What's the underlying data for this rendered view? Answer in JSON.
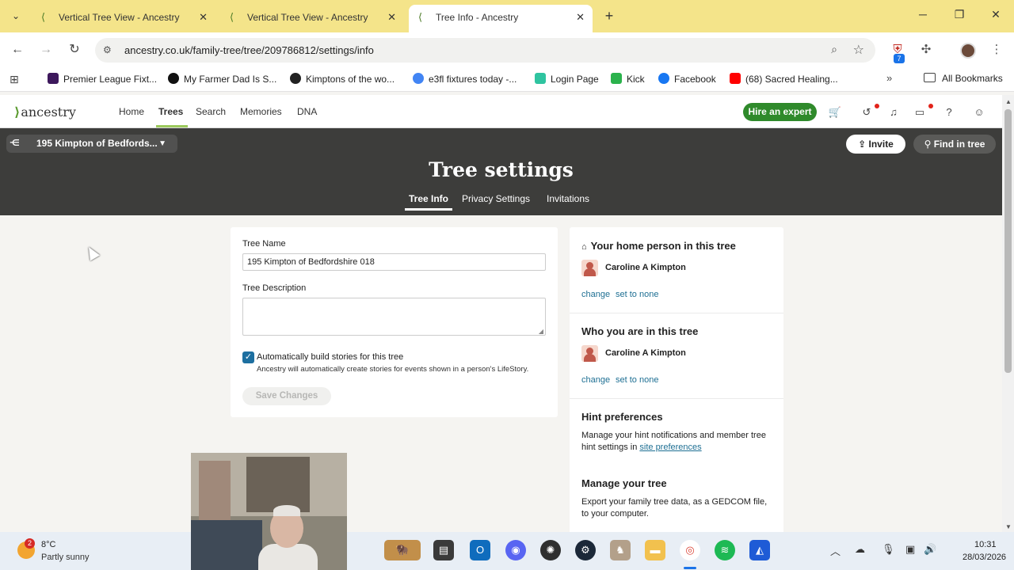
{
  "browser": {
    "tabs": [
      {
        "title": "Vertical Tree View - Ancestry",
        "icon": "ancestry-leaf-icon"
      },
      {
        "title": "Vertical Tree View - Ancestry",
        "icon": "ancestry-leaf-icon"
      },
      {
        "title": "Tree Info - Ancestry",
        "icon": "ancestry-leaf-icon",
        "active": true
      }
    ],
    "url": "ancestry.co.uk/family-tree/tree/209786812/settings/info",
    "extension_badge": "7",
    "bookmarks": [
      {
        "label": "Premier League Fixt...",
        "color": "#3d185c"
      },
      {
        "label": "My Farmer Dad Is S...",
        "color": "#111111"
      },
      {
        "label": "Kimptons of the wo...",
        "color": "#222222"
      },
      {
        "label": "e3fl fixtures today -...",
        "color": "#4285f4"
      },
      {
        "label": "Login Page",
        "color": "#2fc4a0"
      },
      {
        "label": "Kick",
        "color": "#2bb24c"
      },
      {
        "label": "Facebook",
        "color": "#1877f2"
      },
      {
        "label": "(68) Sacred Healing...",
        "color": "#ff0000"
      }
    ],
    "all_bookmarks": "All Bookmarks"
  },
  "site": {
    "logo": "ancestry",
    "nav": [
      "Home",
      "Trees",
      "Search",
      "Memories",
      "DNA"
    ],
    "active_nav": "Trees",
    "hire_button": "Hire an expert",
    "accent": "#2f8a2b"
  },
  "banner": {
    "tree_selector": "195 Kimpton of Bedfords...",
    "invite": "Invite",
    "find_in_tree": "Find in tree",
    "title": "Tree settings",
    "tabs": [
      "Tree Info",
      "Privacy Settings",
      "Invitations"
    ],
    "active_tab": "Tree Info"
  },
  "form": {
    "tree_name_label": "Tree Name",
    "tree_name_value": "195 Kimpton of Bedfordshire 018",
    "tree_description_label": "Tree Description",
    "tree_description_value": "",
    "auto_stories_checked": true,
    "auto_stories_label": "Automatically build stories for this tree",
    "auto_stories_desc": "Ancestry will automatically create stories for events shown in a person's LifeStory.",
    "save_button": "Save Changes"
  },
  "sidebar": {
    "home_person": {
      "heading": "Your home person in this tree",
      "name": "Caroline A Kimpton",
      "change": "change",
      "set_none": "set to none"
    },
    "who_you_are": {
      "heading": "Who you are in this tree",
      "name": "Caroline A Kimpton",
      "change": "change",
      "set_none": "set to none"
    },
    "hints": {
      "heading": "Hint preferences",
      "text": "Manage your hint notifications and member tree hint settings in",
      "link": "site preferences"
    },
    "manage": {
      "heading": "Manage your tree",
      "text": "Export your family tree data, as a GEDCOM file, to your computer."
    }
  },
  "taskbar": {
    "weather_badge": "2",
    "temperature": "8°C",
    "weather": "Partly sunny",
    "time": "10:31",
    "date": "28/03/2026"
  }
}
